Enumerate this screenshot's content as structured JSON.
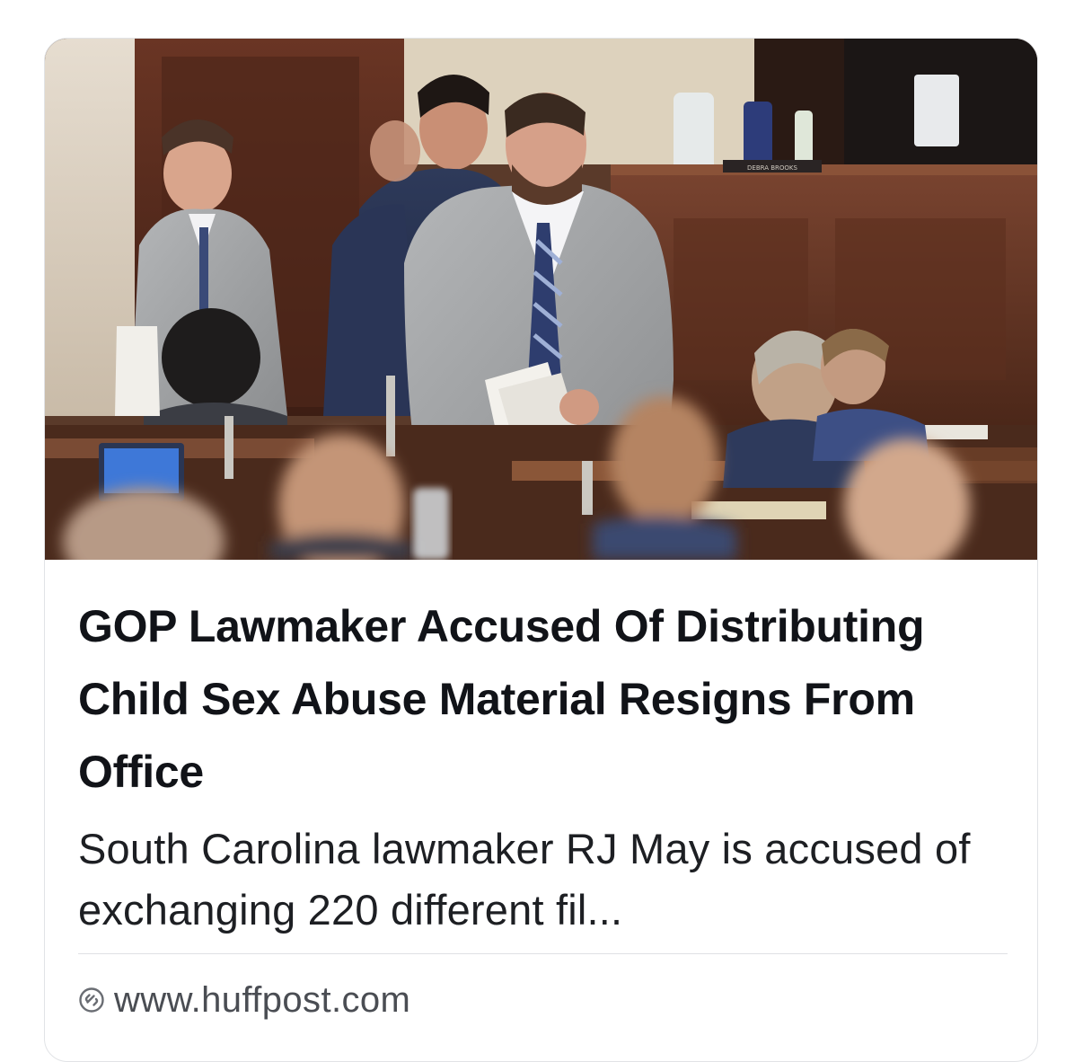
{
  "article": {
    "title": "GOP Lawmaker Accused Of Distributing Child Sex Abuse Material Resigns From Office",
    "description": "South Carolina lawmaker RJ May is accused of exchanging 220 different fil...",
    "source_url": "www.huffpost.com",
    "image_alt": "Lawmaker in a gray suit walking among seated legislators in a chamber",
    "image_text": {
      "nameplate": "DEBRA BROOKS"
    }
  },
  "icons": {
    "link": "link-icon"
  },
  "colors": {
    "title": "#111318",
    "description": "#1d1f23",
    "source": "#4a4d53",
    "border": "#e1e3e6"
  }
}
